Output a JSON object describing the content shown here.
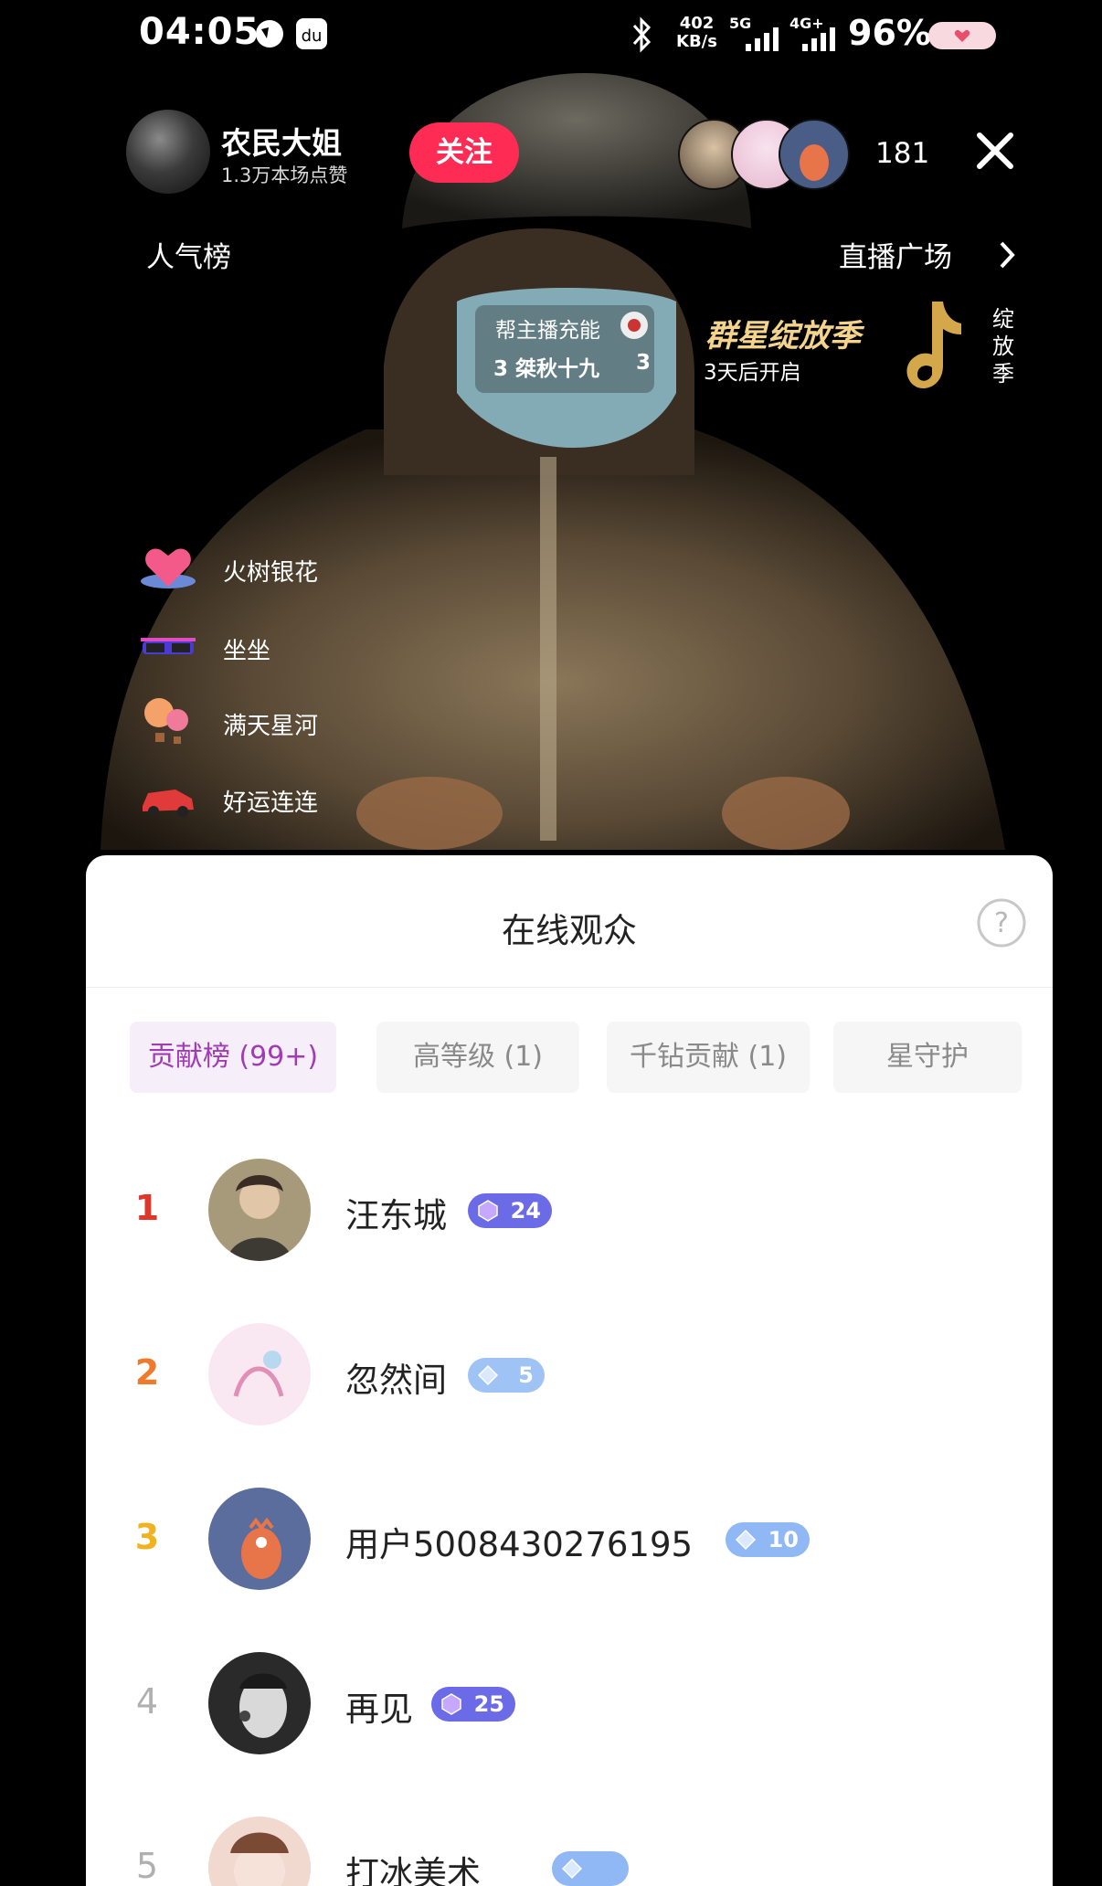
{
  "status_bar": {
    "time": "04:05",
    "net_speed_value": "402",
    "net_speed_unit": "KB/s",
    "net1": "5G",
    "net2": "4G+",
    "battery": "96%"
  },
  "header": {
    "anchor_name": "农民大姐",
    "likes": "1.3万本场点赞",
    "follow_label": "关注",
    "viewer_count": "181"
  },
  "top_row": {
    "popularity": "人气榜",
    "live_square": "直播广场"
  },
  "charge": {
    "title": "帮主播充能",
    "user": "3 桀秋十九",
    "count": "3"
  },
  "season": {
    "title": "群星绽放季",
    "subtitle": "3天后开启",
    "side_label": "绽放季"
  },
  "gifts": [
    {
      "label": "火树银花",
      "icon": "heart-gift-icon"
    },
    {
      "label": "坐坐",
      "icon": "sunglasses-gift-icon"
    },
    {
      "label": "满天星河",
      "icon": "balloon-gift-icon"
    },
    {
      "label": "好运连连",
      "icon": "car-gift-icon"
    }
  ],
  "sheet": {
    "title": "在线观众",
    "tabs": [
      "贡献榜 (99+)",
      "高等级 (1)",
      "千钻贡献 (1)",
      "星守护"
    ],
    "active_tab": 0,
    "rows": [
      {
        "rank": "1",
        "name": "汪东城",
        "level": "24",
        "rank_color": "#e0352b"
      },
      {
        "rank": "2",
        "name": "忽然间",
        "level": "5",
        "rank_color": "#ef7a2c"
      },
      {
        "rank": "3",
        "name": "用户5008430276195",
        "level": "10",
        "rank_color": "#f0b31f"
      },
      {
        "rank": "4",
        "name": "再见",
        "level": "25",
        "rank_color": "#b0b0b0"
      },
      {
        "rank": "5",
        "name": "打冰美术",
        "level": "",
        "rank_color": "#b0b0b0"
      }
    ]
  },
  "colors": {
    "follow": "#fe2c55",
    "active_tab_text": "#a03cb4",
    "badge_purple": "#6b6be8",
    "badge_blue": "#8fb8f5"
  }
}
